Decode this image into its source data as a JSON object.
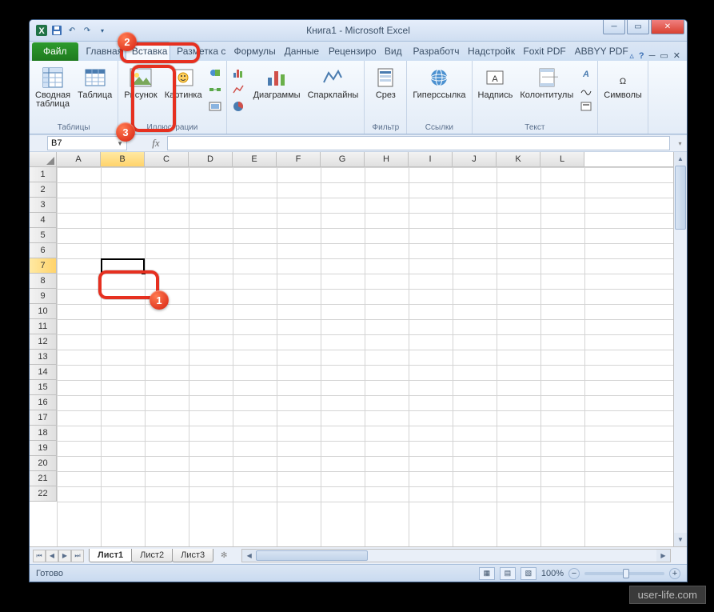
{
  "window": {
    "title": "Книга1 - Microsoft Excel",
    "qat": {
      "excel": "X",
      "save": "💾",
      "undo": "↶",
      "redo": "↷",
      "dd": "▾"
    }
  },
  "tabs": {
    "file": "Файл",
    "items": [
      "Главная",
      "Вставка",
      "Разметка с",
      "Формулы",
      "Данные",
      "Рецензиро",
      "Вид",
      "Разработч",
      "Надстройк",
      "Foxit PDF",
      "ABBYY PDF"
    ],
    "active_index": 1
  },
  "ribbon": {
    "groups": {
      "tables": {
        "name": "Таблицы",
        "pivot": "Сводная\nтаблица",
        "table": "Таблица"
      },
      "illus": {
        "name": "Иллюстрации",
        "picture": "Рисунок",
        "clipart": "Картинка"
      },
      "charts": {
        "name": "",
        "charts": "Диаграммы",
        "spark": "Спарклайны"
      },
      "filter": {
        "name": "Фильтр",
        "slicer": "Срез"
      },
      "links": {
        "name": "Ссылки",
        "hyper": "Гиперссылка"
      },
      "text": {
        "name": "Текст",
        "textbox": "Надпись",
        "header": "Колонтитулы"
      },
      "symbols": {
        "name": "",
        "sym": "Символы"
      }
    }
  },
  "namebox": {
    "cell": "B7",
    "fx": "fx"
  },
  "grid": {
    "cols": [
      "A",
      "B",
      "C",
      "D",
      "E",
      "F",
      "G",
      "H",
      "I",
      "J",
      "K",
      "L"
    ],
    "rows_start": 1,
    "rows_end": 22,
    "selected_col": 1,
    "selected_row": 7
  },
  "sheets": {
    "tabs": [
      "Лист1",
      "Лист2",
      "Лист3"
    ],
    "active": 0
  },
  "status": {
    "ready": "Готово",
    "zoom": "100%",
    "minus": "−",
    "plus": "+"
  },
  "callouts": {
    "c1": "1",
    "c2": "2",
    "c3": "3"
  },
  "watermark": "user-life.com"
}
